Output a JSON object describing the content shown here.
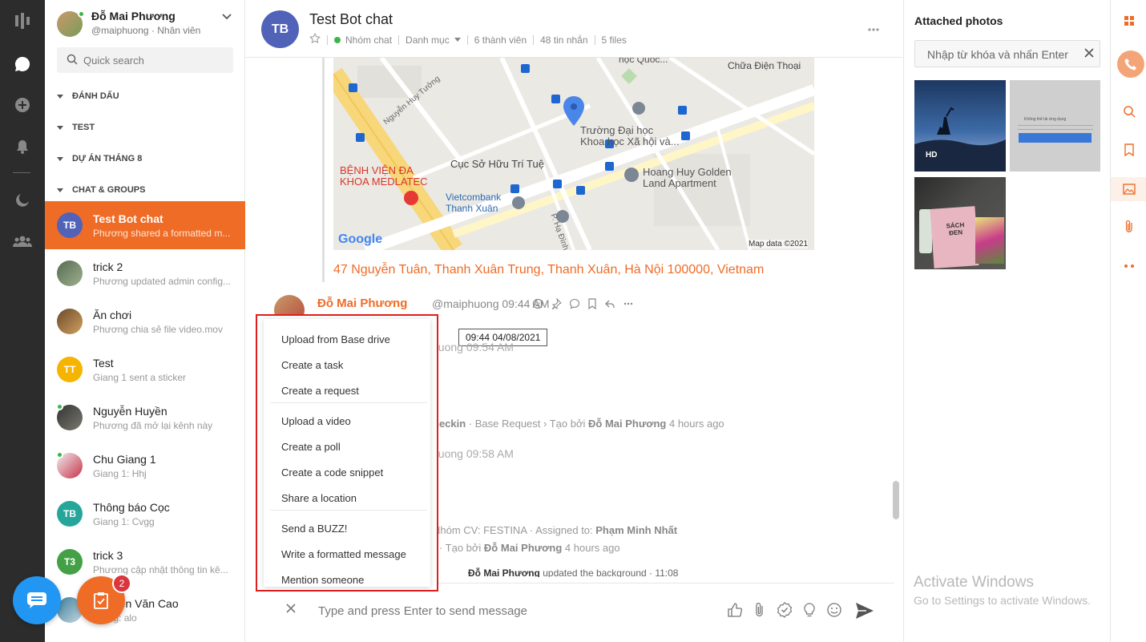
{
  "user": {
    "name": "Đỗ Mai Phương",
    "handle": "@maiphuong · Nhân viên"
  },
  "search": {
    "placeholder": "Quick search"
  },
  "sections": [
    "ĐÁNH DẤU",
    "TEST",
    "DỰ ÁN THÁNG 8",
    "CHAT & GROUPS"
  ],
  "conversations": [
    {
      "initials": "TB",
      "title": "Test Bot chat",
      "sub": "Phương shared a formatted m...",
      "color": "#5063b9",
      "active": true
    },
    {
      "initials": "",
      "title": "trick 2",
      "sub": "Phương updated admin config...",
      "color": "#6d7f6a"
    },
    {
      "initials": "",
      "title": "Ăn chơi",
      "sub": "Phương chia sẻ file video.mov",
      "color": "#8a6a3a"
    },
    {
      "initials": "TT",
      "title": "Test",
      "sub": "Giang 1 sent a sticker",
      "color": "#f5b400"
    },
    {
      "initials": "",
      "title": "Nguyễn Huyền",
      "sub": "Phương đã mở lại kênh này",
      "color": "#4a4a48",
      "online": true
    },
    {
      "initials": "",
      "title": "Chu Giang 1",
      "sub": "Giang 1: Hhj",
      "color": "#c8324a",
      "online": true
    },
    {
      "initials": "TB",
      "title": "Thông báo Cọc",
      "sub": "Giang 1: Cvgg",
      "color": "#26a69a"
    },
    {
      "initials": "T3",
      "title": "trick 3",
      "sub": "Phương cập nhật thông tin kê...",
      "color": "#43a047"
    },
    {
      "initials": "",
      "title": "Nguyễn Văn Cao",
      "sub": "Giang: alo",
      "color": "#3b7d9b"
    }
  ],
  "chat": {
    "title": "Test Bot chat",
    "initials": "TB",
    "type": "Nhóm chat",
    "category": "Danh mục",
    "members": "6 thành viên",
    "messages": "48 tin nhắn",
    "files": "5 files"
  },
  "map": {
    "labels": {
      "school_quoc": "học Quốc...",
      "phone_repair": "Chữa Điện Thoại",
      "nguyen_huy_tuong": "Nguyễn Huy Tưởng",
      "university": "Trường Đại học\nKhoa học Xã hội và...",
      "cuc_so_huu": "Cục Sở Hữu Trí Tuệ",
      "hospital": "BỆNH VIỆN ĐA\nKHOA MEDLATEC",
      "hoang_huy": "Hoang Huy Golden\nLand Apartment",
      "vietcombank": "Vietcombank\nThanh Xuân",
      "p_ha_dinh": "P. Hạ Đình",
      "google": "Google",
      "map_data": "Map data ©2021"
    },
    "address": "47 Nguyễn Tuân, Thanh Xuân Trung, Thanh Xuân, Hà Nội 100000, Vietnam"
  },
  "message": {
    "author": "Đỗ Mai Phương",
    "handle": "@maiphuong",
    "time": "09:44 AM",
    "tooltip": "09:44 04/08/2021"
  },
  "faded": {
    "line1": "huong 09:54 AM",
    "line2_prefix": "heckin",
    "line2_rest": " · Base Request › Tạo bởi ",
    "line2_author": "Đỗ Mai Phương",
    "line2_time": " 4 hours ago",
    "line3": "huong 09:58 AM",
    "line4_prefix": "Nhóm CV: FESTINA · Assigned to: ",
    "line4_person": "Phạm Minh Nhất",
    "line5_prefix": "‹ · Tạo bởi ",
    "line5_author": "Đỗ Mai Phương",
    "line5_time": " 4 hours ago"
  },
  "system": {
    "author": "Đỗ Mai Phương",
    "text": " updated the background · 11:08"
  },
  "menu": {
    "group1": [
      "Upload from Base drive",
      "Create a task",
      "Create a request"
    ],
    "group2": [
      "Upload a video",
      "Create a poll",
      "Create a code snippet",
      "Share a location"
    ],
    "group3": [
      "Send a BUZZ!",
      "Write a formatted message",
      "Mention someone"
    ]
  },
  "composer": {
    "placeholder": "Type and press Enter to send message"
  },
  "right": {
    "title": "Attached photos",
    "search_placeholder": "Nhập từ khóa và nhấn Enter",
    "photo1_badge": "HD",
    "photo2_text": "Không thể tải ứng dụng",
    "photo3_text": "SÁCH ĐEN"
  },
  "watermark": {
    "title": "Activate Windows",
    "sub": "Go to Settings to activate Windows."
  },
  "badge_count": "2",
  "colors": {
    "accent": "#ef6c27",
    "rail": "#2c2c2c",
    "blue": "#2196f3",
    "highlight_border": "#e01e1e"
  }
}
